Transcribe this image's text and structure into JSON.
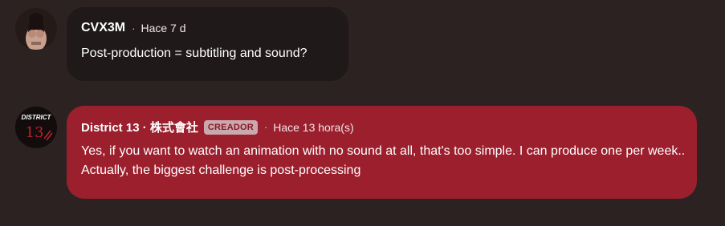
{
  "comments": [
    {
      "author": "CVX3M",
      "separator": "·",
      "time": "Hace 7 d",
      "text": "Post-production = subtitling and sound?",
      "avatar_icon": "user-avatar-photo"
    },
    {
      "author": "District 13 · 株式會社",
      "badge": "CREADOR",
      "separator": "·",
      "time": "Hace 13 hora(s)",
      "text": "Yes, if you want to watch an animation with no sound at all, that's too simple. I can produce one per week.. Actually, the biggest challenge is post-processing",
      "avatar_icon": "district-13-logo",
      "avatar_logo_text": "DISTRICT",
      "avatar_logo_number": "13"
    }
  ],
  "colors": {
    "page_background": "#2c2222",
    "bubble_dark": "#1f1919",
    "bubble_creator": "#9c1f2d",
    "badge_background": "#c9a9ad",
    "badge_text": "#8a1826"
  }
}
